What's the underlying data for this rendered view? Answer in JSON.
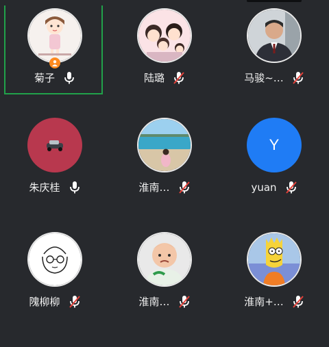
{
  "participants": [
    {
      "name": "菊子",
      "mic": "on",
      "active": true,
      "host": true,
      "avatar": "cartoon-girl-avatar"
    },
    {
      "name": "陆璐",
      "mic": "off",
      "avatar": "family-cartoon-avatar"
    },
    {
      "name": "马骏~…",
      "mic": "off",
      "avatar": "man-photo-avatar"
    },
    {
      "name": "朱庆桂",
      "mic": "on",
      "avatar": "toy-car-avatar"
    },
    {
      "name": "淮南…",
      "mic": "off",
      "avatar": "beach-photo-avatar"
    },
    {
      "name": "yuan",
      "mic": "off",
      "avatar": "letter-avatar",
      "initial": "Y"
    },
    {
      "name": "隗柳柳",
      "mic": "off",
      "avatar": "sketch-face-avatar"
    },
    {
      "name": "淮南…",
      "mic": "off",
      "avatar": "baby-photo-avatar"
    },
    {
      "name": "淮南+…",
      "mic": "off",
      "avatar": "simpson-cartoon-avatar"
    }
  ],
  "colors": {
    "background": "#27292d",
    "active_border": "#21a24a",
    "mic_on": "#ffffff",
    "mic_off_slash": "#e5413a",
    "host_badge": "#ff8a1f",
    "letter_avatar": "#1f7cf5"
  },
  "icons": {
    "mic_on": "mic-icon",
    "mic_off": "mic-muted-icon",
    "host": "host-badge-icon"
  }
}
